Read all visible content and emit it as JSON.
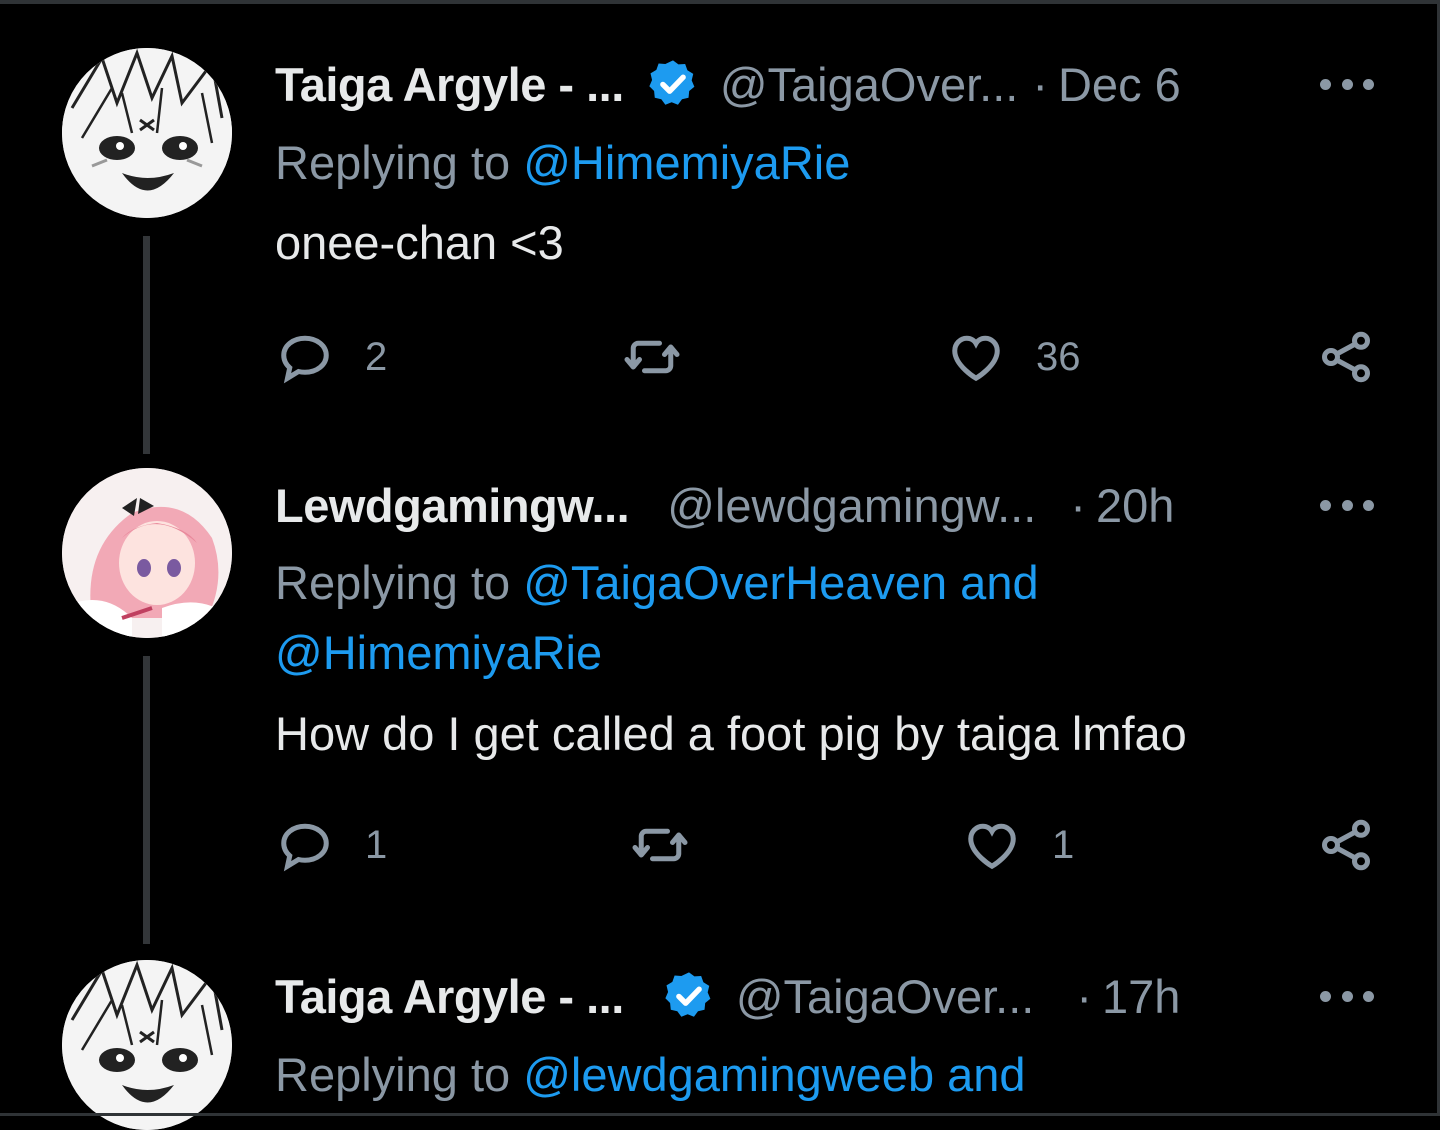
{
  "colors": {
    "background": "#000000",
    "text": "#e7e9ea",
    "muted": "#8b98a5",
    "link": "#1d9bf0",
    "verified": "#1d9bf0",
    "thread_line": "#333639"
  },
  "tweets": [
    {
      "name": "Taiga Argyle - ...",
      "handle": "@TaigaOver...",
      "time": "Dec 6",
      "verified": true,
      "reply_prefix": "Replying to ",
      "mentions_line1": "@HimemiyaRie",
      "mentions_line2": "",
      "text": "onee-chan <3",
      "reply_count": "2",
      "retweet_count": "",
      "like_count": "36",
      "avatar_icon": "manga-face-avatar"
    },
    {
      "name": "Lewdgamingw...",
      "handle": "@lewdgamingw...",
      "time": "20h",
      "verified": false,
      "reply_prefix": "Replying to ",
      "mentions_line1": "@TaigaOverHeaven and",
      "mentions_line2": "@HimemiyaRie",
      "text": "How do I get called a foot pig by taiga lmfao",
      "reply_count": "1",
      "retweet_count": "",
      "like_count": "1",
      "avatar_icon": "pink-hair-anime-avatar"
    },
    {
      "name": "Taiga Argyle - ...",
      "handle": "@TaigaOver...",
      "time": "17h",
      "verified": true,
      "reply_prefix": "Replying to ",
      "mentions_line1": "@lewdgamingweeb and",
      "avatar_icon": "manga-face-avatar"
    }
  ],
  "separator": "·",
  "icons": {
    "reply": "reply-icon",
    "retweet": "retweet-icon",
    "like": "like-icon",
    "share": "share-icon",
    "more": "more-icon",
    "verified": "verified-badge-icon"
  }
}
